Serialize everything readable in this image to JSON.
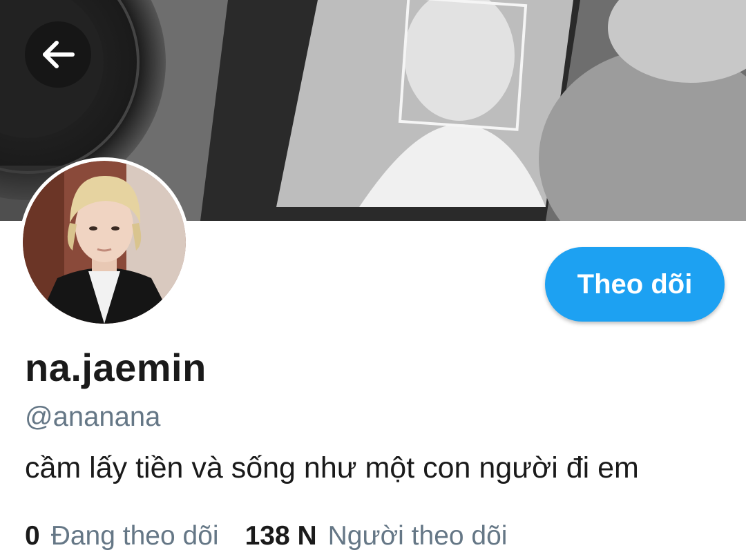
{
  "profile": {
    "display_name": "na.jaemin",
    "handle": "@ananana",
    "bio": "cầm lấy tiền và sống như một con người đi em",
    "follow_label": "Theo dõi"
  },
  "stats": {
    "following_count": "0",
    "following_label": "Đang theo dõi",
    "followers_count": "138 N",
    "followers_label": "Người theo dõi"
  },
  "icons": {
    "back": "arrow-left-icon"
  },
  "colors": {
    "accent": "#1da1f2",
    "secondary_text": "#657786",
    "primary_text": "#1a1a1a"
  }
}
